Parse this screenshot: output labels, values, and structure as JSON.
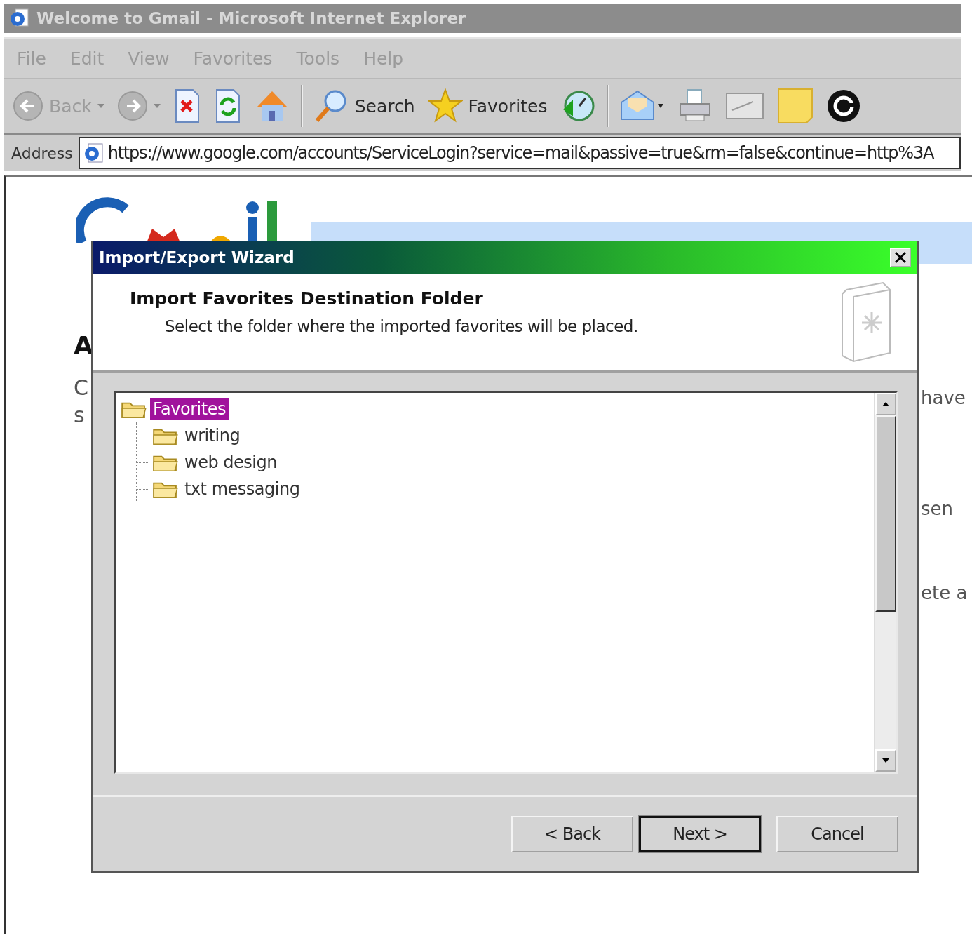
{
  "window": {
    "title": "Welcome to Gmail - Microsoft Internet Explorer"
  },
  "menu": [
    {
      "label": "File"
    },
    {
      "label": "Edit"
    },
    {
      "label": "View"
    },
    {
      "label": "Favorites"
    },
    {
      "label": "Tools"
    },
    {
      "label": "Help"
    }
  ],
  "toolbar": [
    {
      "kind": "back",
      "label": "Back",
      "disabled": true
    },
    {
      "kind": "forward",
      "disabled": true
    },
    {
      "kind": "stop"
    },
    {
      "kind": "refresh"
    },
    {
      "kind": "home"
    },
    {
      "kind": "separator"
    },
    {
      "kind": "search",
      "label": "Search",
      "disabled": false
    },
    {
      "kind": "favorites",
      "label": "Favorites",
      "disabled": false
    },
    {
      "kind": "history"
    },
    {
      "kind": "separator"
    },
    {
      "kind": "mail"
    },
    {
      "kind": "print"
    },
    {
      "kind": "edit"
    },
    {
      "kind": "note"
    },
    {
      "kind": "blog"
    }
  ],
  "address": {
    "label": "Address",
    "value": "https://www.google.com/accounts/ServiceLogin?service=mail&passive=true&rm=false&continue=http%3A"
  },
  "page": {
    "left_fragments": [
      "A",
      "C",
      "s"
    ],
    "right_fragments": [
      "have",
      "sen",
      "ete a"
    ]
  },
  "dialog": {
    "title": "Import/Export Wizard",
    "heading": "Import Favorites Destination Folder",
    "subtitle": "Select the folder where the imported favorites will be placed.",
    "tree": [
      {
        "label": "Favorites",
        "selected": true,
        "children": [
          {
            "label": "writing",
            "selected": false
          },
          {
            "label": "web design",
            "selected": false
          },
          {
            "label": "txt messaging",
            "selected": false
          }
        ]
      }
    ],
    "buttons": [
      {
        "label": "< Back",
        "default": false
      },
      {
        "label": "Next >",
        "default": true
      },
      {
        "label": "Cancel",
        "default": false
      }
    ]
  }
}
